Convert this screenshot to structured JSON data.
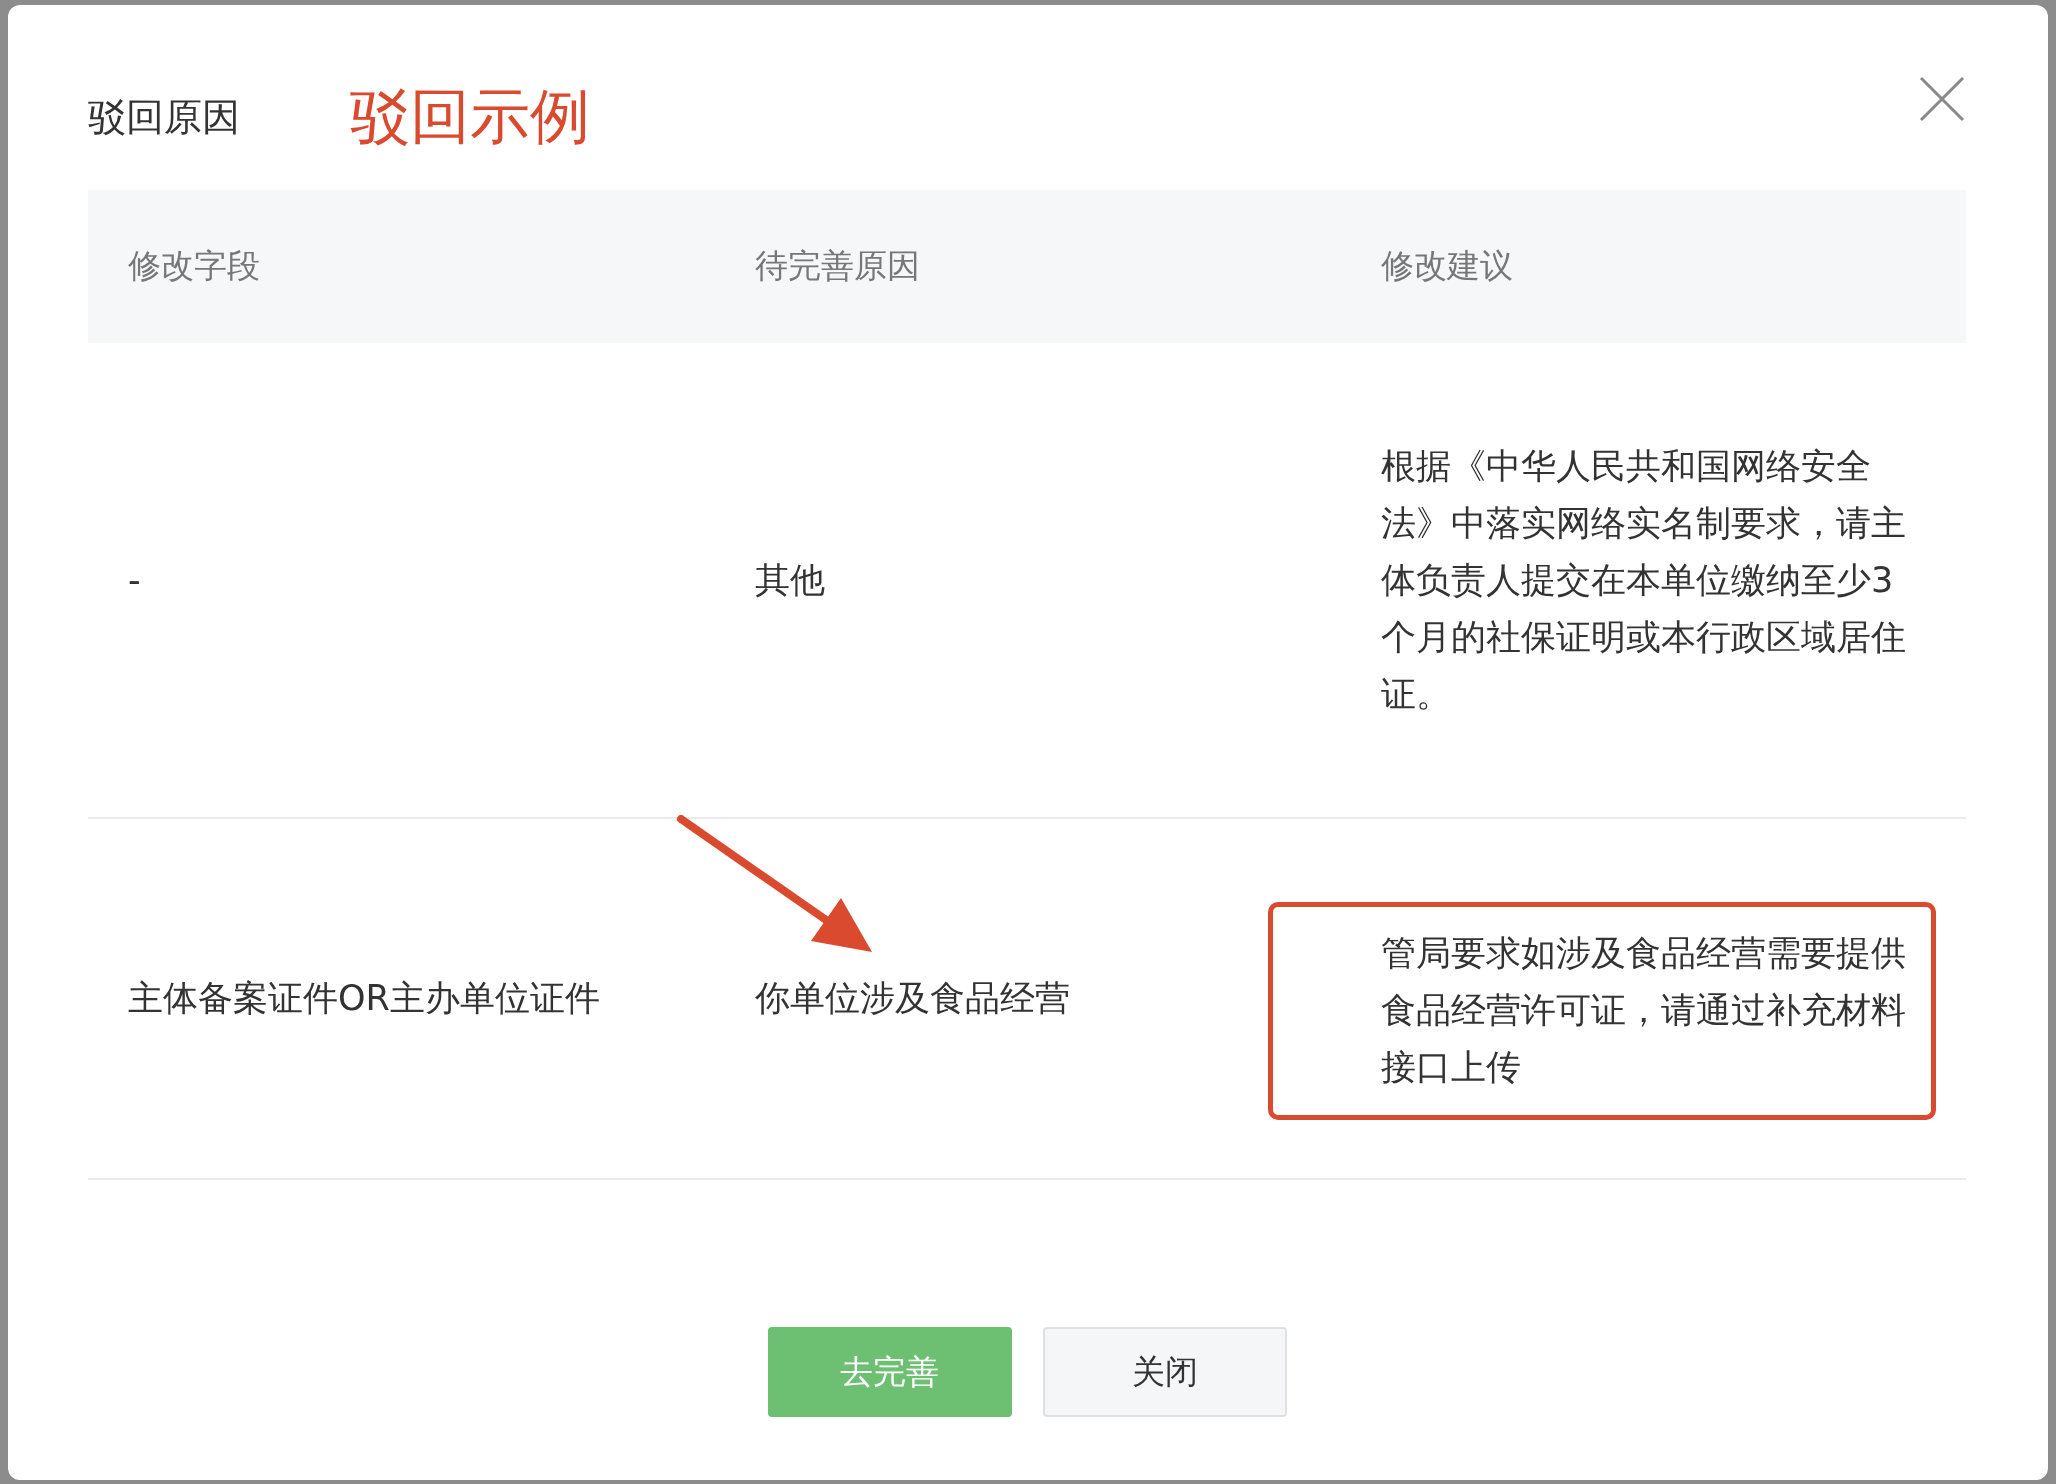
{
  "dialog": {
    "title": "驳回原因",
    "annotation_label": "驳回示例"
  },
  "table": {
    "columns": [
      "修改字段",
      "待完善原因",
      "修改建议"
    ],
    "rows": [
      {
        "field": "-",
        "reason": "其他",
        "suggestion": "根据《中华人民共和国网络安全法》中落实网络实名制要求，请主体负责人提交在本单位缴纳至少3个月的社保证明或本行政区域居住证。",
        "highlighted": false
      },
      {
        "field": "主体备案证件OR主办单位证件",
        "reason": "你单位涉及食品经营",
        "suggestion": "管局要求如涉及食品经营需要提供食品经营许可证，请通过补充材料接口上传",
        "highlighted": true
      }
    ]
  },
  "buttons": [
    {
      "label": "去完善",
      "kind": "primary"
    },
    {
      "label": "关闭",
      "kind": "default"
    }
  ]
}
